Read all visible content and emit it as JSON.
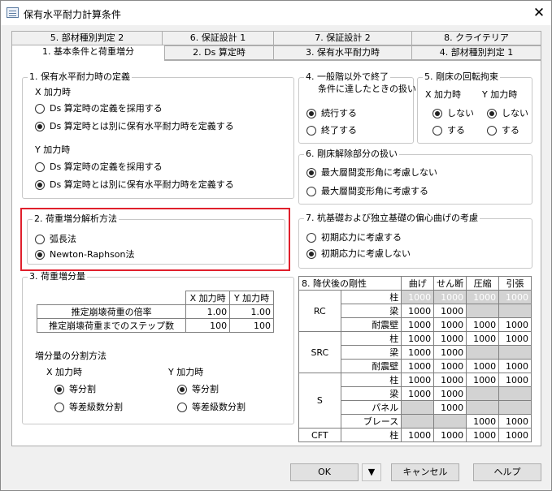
{
  "window": {
    "title": "保有水平耐力計算条件",
    "close": "✕"
  },
  "tabs_back": [
    "5. 部材種別判定 2",
    "6. 保証設計 1",
    "7. 保証設計 2",
    "8. クライテリア"
  ],
  "tabs_front": [
    "1. 基本条件と荷重増分",
    "2. Ds 算定時",
    "3. 保有水平耐力時",
    "4. 部材種別判定 1"
  ],
  "g1": {
    "title": "1. 保有水平耐力時の定義",
    "x_label": "X 加力時",
    "y_label": "Y 加力時",
    "opt1": "Ds 算定時の定義を採用する",
    "opt2": "Ds 算定時とは別に保有水平耐力時を定義する"
  },
  "g2": {
    "title": "2. 荷重増分解析方法",
    "opt1": "弧長法",
    "opt2": "Newton-Raphson法"
  },
  "g3": {
    "title": "3. 荷重増分量",
    "col_x": "X 加力時",
    "col_y": "Y 加力時",
    "rows": [
      {
        "label": "推定崩壊荷重の倍率",
        "x": "1.00",
        "y": "1.00"
      },
      {
        "label": "推定崩壊荷重までのステップ数",
        "x": "100",
        "y": "100"
      }
    ],
    "div_title": "増分量の分割方法",
    "x_label": "X 加力時",
    "y_label": "Y 加力時",
    "opt1": "等分割",
    "opt2": "等差級数分割"
  },
  "g4": {
    "title1": "4. 一般階以外で終了",
    "title2": "条件に達したときの扱い",
    "opt1": "続行する",
    "opt2": "終了する"
  },
  "g5": {
    "title": "5. 剛床の回転拘束",
    "x_label": "X 加力時",
    "y_label": "Y 加力時",
    "opt1": "しない",
    "opt2": "する"
  },
  "g6": {
    "title": "6. 剛床解除部分の扱い",
    "opt1": "最大層間変形角に考慮しない",
    "opt2": "最大層間変形角に考慮する"
  },
  "g7": {
    "title": "7. 杭基礎および独立基礎の偏心曲げの考慮",
    "opt1": "初期応力に考慮する",
    "opt2": "初期応力に考慮しない"
  },
  "g8": {
    "header": [
      "8. 降伏後の剛性",
      "曲げ",
      "せん断",
      "圧縮",
      "引張"
    ],
    "groups": [
      {
        "name": "RC",
        "rows": [
          {
            "label": "柱",
            "v": [
              "1000",
              "1000",
              "1000",
              "1000"
            ],
            "c": [
              "g",
              "g",
              "g",
              "g"
            ]
          },
          {
            "label": "梁",
            "v": [
              "1000",
              "1000",
              "",
              ""
            ],
            "c": [
              "w",
              "w",
              "g",
              "g"
            ]
          },
          {
            "label": "耐震壁",
            "v": [
              "1000",
              "1000",
              "1000",
              "1000"
            ],
            "c": [
              "w",
              "w",
              "w",
              "w"
            ]
          }
        ]
      },
      {
        "name": "SRC",
        "rows": [
          {
            "label": "柱",
            "v": [
              "1000",
              "1000",
              "1000",
              "1000"
            ],
            "c": [
              "w",
              "w",
              "w",
              "w"
            ]
          },
          {
            "label": "梁",
            "v": [
              "1000",
              "1000",
              "",
              ""
            ],
            "c": [
              "w",
              "w",
              "g",
              "g"
            ]
          },
          {
            "label": "耐震壁",
            "v": [
              "1000",
              "1000",
              "1000",
              "1000"
            ],
            "c": [
              "w",
              "w",
              "w",
              "w"
            ]
          }
        ]
      },
      {
        "name": "S",
        "rows": [
          {
            "label": "柱",
            "v": [
              "1000",
              "1000",
              "1000",
              "1000"
            ],
            "c": [
              "w",
              "w",
              "w",
              "w"
            ]
          },
          {
            "label": "梁",
            "v": [
              "1000",
              "1000",
              "",
              ""
            ],
            "c": [
              "w",
              "w",
              "g",
              "g"
            ]
          },
          {
            "label": "パネル",
            "v": [
              "",
              "1000",
              "",
              ""
            ],
            "c": [
              "g",
              "w",
              "g",
              "g"
            ]
          },
          {
            "label": "ブレース",
            "v": [
              "",
              "",
              "1000",
              "1000"
            ],
            "c": [
              "g",
              "g",
              "w",
              "w"
            ]
          }
        ]
      },
      {
        "name": "CFT",
        "rows": [
          {
            "label": "柱",
            "v": [
              "1000",
              "1000",
              "1000",
              "1000"
            ],
            "c": [
              "w",
              "w",
              "w",
              "w"
            ]
          }
        ]
      }
    ]
  },
  "buttons": {
    "ok": "OK",
    "dropdown": "▼",
    "cancel": "キャンセル",
    "help": "ヘルプ"
  }
}
